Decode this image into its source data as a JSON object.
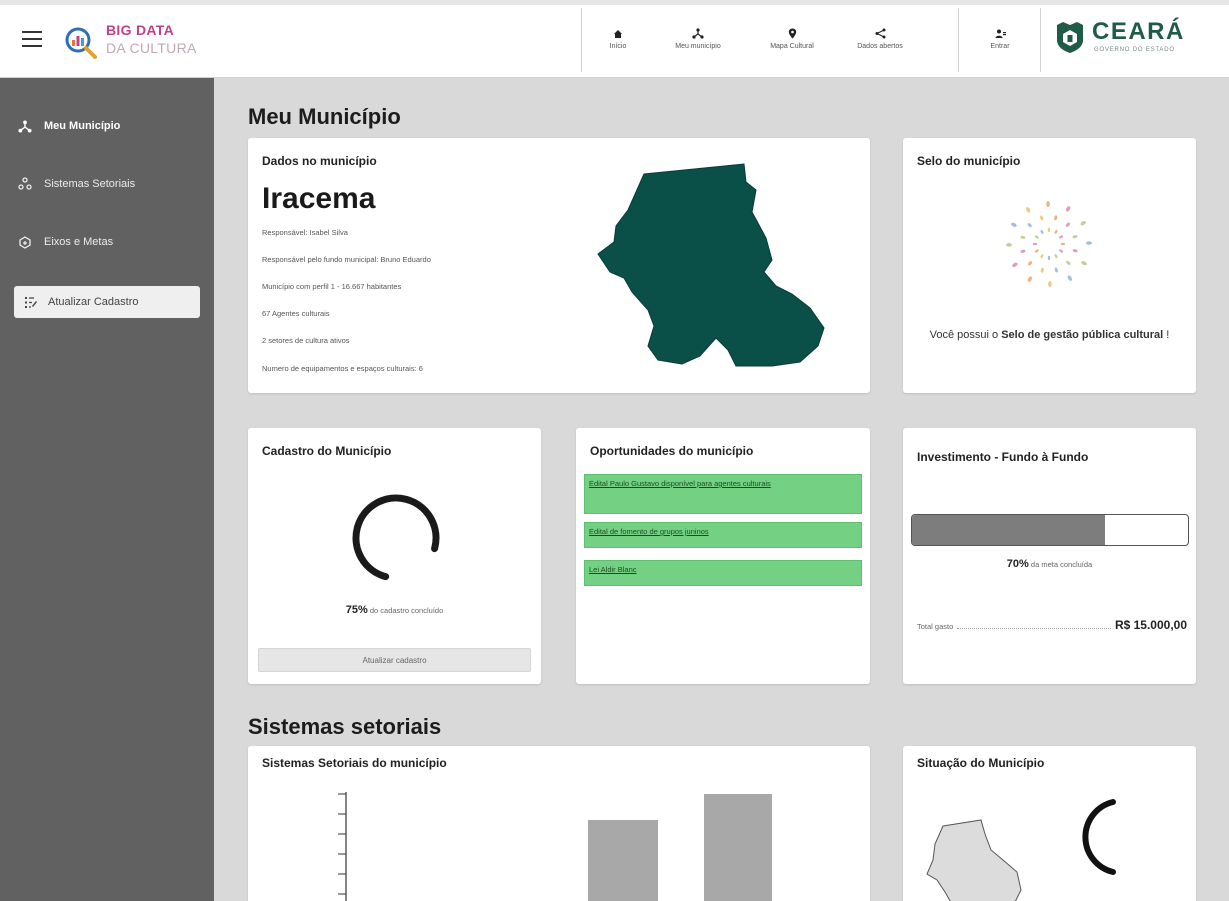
{
  "header": {
    "logo_line1": "BIG DATA",
    "logo_line2": "DA CULTURA",
    "nav": [
      {
        "label": "Início",
        "icon": "home-icon"
      },
      {
        "label": "Meu município",
        "icon": "network-icon"
      },
      {
        "label": "Mapa Cultural",
        "icon": "map-pin-icon"
      },
      {
        "label": "Dados abertos",
        "icon": "share-icon"
      }
    ],
    "login_label": "Entrar",
    "brand_name": "CEARÁ",
    "brand_sub": "GOVERNO DO ESTADO"
  },
  "sidebar": {
    "items": [
      {
        "label": "Meu Município",
        "icon": "network-icon"
      },
      {
        "label": "Sistemas Setoriais",
        "icon": "people-icon"
      },
      {
        "label": "Eixos e Metas",
        "icon": "target-icon"
      },
      {
        "label": "Atualizar Cadastro",
        "icon": "edit-list-icon"
      }
    ]
  },
  "main": {
    "title": "Meu Município",
    "dados": {
      "title": "Dados no município",
      "name": "Iracema",
      "lines": [
        "Responsável: Isabel Silva",
        "Responsável pelo fundo municipal: Bruno Eduardo",
        "Município com perfil 1 - 16.667 habitantes",
        "67 Agentes culturais",
        "2 setores de cultura ativos",
        "Numero de equipamentos e espaços culturais: 6"
      ]
    },
    "selo": {
      "title": "Selo do município",
      "text_before": "Você possui o ",
      "text_bold": "Selo de gestão pública cultural",
      "text_after": " !"
    },
    "cadastro": {
      "title": "Cadastro do Município",
      "percent": "75%",
      "percent_label": " do cadastro concluído",
      "progress": 0.75,
      "button_label": "Atualizar cadastro"
    },
    "oportunidades": {
      "title": "Oportunidades do município",
      "items": [
        "Edital Paulo Gustavo disponível para agentes culturais",
        "Edital de fomento de grupos juninos",
        "Lei Aldir Blanc"
      ]
    },
    "investimento": {
      "title": "Investimento - Fundo à Fundo",
      "percent": "70%",
      "percent_label": " da meta concluída",
      "progress": 0.7,
      "total_label": "Total gasto",
      "total_value": "R$ 15.000,00"
    },
    "sistemas": {
      "title": "Sistemas setoriais",
      "chart_title": "Sistemas Setoriais do município",
      "situacao_title": "Situação do Município"
    }
  },
  "colors": {
    "map_fill": "#0b5048",
    "opp_green": "#74d184",
    "sidebar_bg": "#616161",
    "brand_green": "#1f5b46",
    "logo_pink": "#c0418a"
  }
}
